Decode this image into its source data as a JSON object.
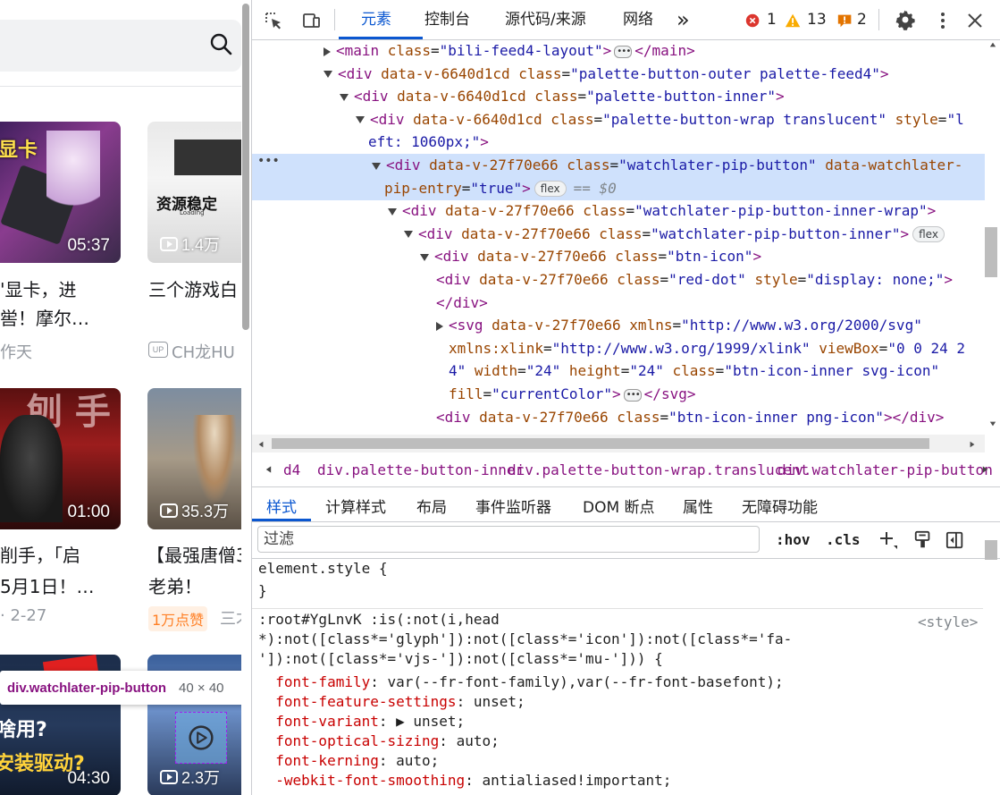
{
  "page": {
    "videos": [
      {
        "thumb_text": "显卡",
        "duration": "05:37",
        "title_line1": "'显卡，进",
        "title_line2": "喾！摩尔…",
        "meta": "作天"
      },
      {
        "thumb_text": "资源稳定",
        "loading": "Loading",
        "plays": "1.4万",
        "title_line1": "三个游戏白",
        "meta_prefix": "UP",
        "meta": "CH龙HU"
      },
      {
        "thumb_text": "刨 手",
        "duration": "01:00",
        "title_line1": "削手，「启",
        "title_line2": "5月1日！…",
        "meta": "· 2-27"
      },
      {
        "plays": "35.3万",
        "title_line1": "【最强唐僧3",
        "title_line2": "老弟！",
        "badge": "1万点赞",
        "meta": "三才"
      },
      {
        "thumb_text1": "啥用?",
        "thumb_text2": "安装驱动?",
        "duration": "04:30"
      },
      {
        "plays": "2.3万"
      }
    ],
    "tooltip": {
      "name": "div.watchlater-pip-button",
      "size": "40 × 40"
    }
  },
  "devtools": {
    "tabs": [
      {
        "label": "元素",
        "active": true
      },
      {
        "label": "控制台"
      },
      {
        "label": "源代码/来源"
      },
      {
        "label": "网络"
      }
    ],
    "more_tabs": "»",
    "counts": {
      "errors": "1",
      "warnings": "13",
      "issues": "2"
    },
    "tree": [
      {
        "indent": 80,
        "tri": "right",
        "parts": [
          [
            "tg",
            "<main "
          ],
          [
            "an",
            "class"
          ],
          [
            "pl",
            "="
          ],
          [
            "av",
            "\"bili-feed4-layout\""
          ],
          [
            "tg",
            ">"
          ]
        ],
        "dots": true,
        "tail": [
          [
            "tg",
            "</main>"
          ]
        ]
      },
      {
        "indent": 80,
        "tri": "down",
        "parts": [
          [
            "tg",
            "<div "
          ],
          [
            "an",
            "data-v-6640d1cd "
          ],
          [
            "an",
            "class"
          ],
          [
            "pl",
            "="
          ],
          [
            "av",
            "\"palette-button-outer palette-feed4\""
          ],
          [
            "tg",
            ">"
          ]
        ]
      },
      {
        "indent": 98,
        "tri": "down",
        "parts": [
          [
            "tg",
            "<div "
          ],
          [
            "an",
            "data-v-6640d1cd "
          ],
          [
            "an",
            "class"
          ],
          [
            "pl",
            "="
          ],
          [
            "av",
            "\"palette-button-inner\""
          ],
          [
            "tg",
            ">"
          ]
        ]
      },
      {
        "indent": 116,
        "tri": "down",
        "parts": [
          [
            "tg",
            "<div "
          ],
          [
            "an",
            "data-v-6640d1cd "
          ],
          [
            "an",
            "class"
          ],
          [
            "pl",
            "="
          ],
          [
            "av",
            "\"palette-button-wrap translucent\" "
          ],
          [
            "an",
            "style"
          ],
          [
            "pl",
            "="
          ],
          [
            "av",
            "\"l"
          ]
        ]
      },
      {
        "indent": 130,
        "tri": "",
        "parts": [
          [
            "av",
            "eft: 1060px;\""
          ],
          [
            "tg",
            ">"
          ]
        ]
      },
      {
        "indent": 134,
        "tri": "down",
        "sel": true,
        "parts": [
          [
            "tg",
            "<div "
          ],
          [
            "an",
            "data-v-27f70e66 "
          ],
          [
            "an",
            "class"
          ],
          [
            "pl",
            "="
          ],
          [
            "av",
            "\"watchlater-pip-button\" "
          ],
          [
            "an",
            "data-watchlater-"
          ]
        ]
      },
      {
        "indent": 148,
        "tri": "",
        "sel": true,
        "parts": [
          [
            "an",
            "pip-entry"
          ],
          [
            "pl",
            "="
          ],
          [
            "av",
            "\"true\""
          ],
          [
            "tg",
            ">"
          ]
        ],
        "pill": "flex",
        "eq": "== $0"
      },
      {
        "indent": 152,
        "tri": "down",
        "parts": [
          [
            "tg",
            "<div "
          ],
          [
            "an",
            "data-v-27f70e66 "
          ],
          [
            "an",
            "class"
          ],
          [
            "pl",
            "="
          ],
          [
            "av",
            "\"watchlater-pip-button-inner-wrap\""
          ],
          [
            "tg",
            ">"
          ]
        ]
      },
      {
        "indent": 170,
        "tri": "down",
        "parts": [
          [
            "tg",
            "<div "
          ],
          [
            "an",
            "data-v-27f70e66 "
          ],
          [
            "an",
            "class"
          ],
          [
            "pl",
            "="
          ],
          [
            "av",
            "\"watchlater-pip-button-inner\""
          ],
          [
            "tg",
            ">"
          ]
        ],
        "pill": "flex"
      },
      {
        "indent": 188,
        "tri": "down",
        "parts": [
          [
            "tg",
            "<div "
          ],
          [
            "an",
            "data-v-27f70e66 "
          ],
          [
            "an",
            "class"
          ],
          [
            "pl",
            "="
          ],
          [
            "av",
            "\"btn-icon\""
          ],
          [
            "tg",
            ">"
          ]
        ]
      },
      {
        "indent": 206,
        "tri": "",
        "parts": [
          [
            "tg",
            "<div "
          ],
          [
            "an",
            "data-v-27f70e66 "
          ],
          [
            "an",
            "class"
          ],
          [
            "pl",
            "="
          ],
          [
            "av",
            "\"red-dot\" "
          ],
          [
            "an",
            "style"
          ],
          [
            "pl",
            "="
          ],
          [
            "av",
            "\"display: none;\""
          ],
          [
            "tg",
            ">"
          ]
        ]
      },
      {
        "indent": 206,
        "tri": "",
        "parts": [
          [
            "tg",
            "</div>"
          ]
        ]
      },
      {
        "indent": 206,
        "tri": "right",
        "parts": [
          [
            "tg",
            "<svg "
          ],
          [
            "an",
            "data-v-27f70e66 "
          ],
          [
            "an",
            "xmlns"
          ],
          [
            "pl",
            "="
          ],
          [
            "av",
            "\"http://www.w3.org/2000/svg\""
          ]
        ]
      },
      {
        "indent": 220,
        "tri": "",
        "parts": [
          [
            "an",
            "xmlns:xlink"
          ],
          [
            "pl",
            "="
          ],
          [
            "av",
            "\"http://www.w3.org/1999/xlink\" "
          ],
          [
            "an",
            "viewBox"
          ],
          [
            "pl",
            "="
          ],
          [
            "av",
            "\"0 0 24 2"
          ]
        ]
      },
      {
        "indent": 220,
        "tri": "",
        "parts": [
          [
            "av",
            "4\" "
          ],
          [
            "an",
            "width"
          ],
          [
            "pl",
            "="
          ],
          [
            "av",
            "\"24\" "
          ],
          [
            "an",
            "height"
          ],
          [
            "pl",
            "="
          ],
          [
            "av",
            "\"24\" "
          ],
          [
            "an",
            "class"
          ],
          [
            "pl",
            "="
          ],
          [
            "av",
            "\"btn-icon-inner svg-icon\""
          ]
        ]
      },
      {
        "indent": 220,
        "tri": "",
        "parts": [
          [
            "an",
            "fill"
          ],
          [
            "pl",
            "="
          ],
          [
            "av",
            "\"currentColor\""
          ],
          [
            "tg",
            ">"
          ]
        ],
        "dots": true,
        "tail": [
          [
            "tg",
            "</svg>"
          ]
        ]
      },
      {
        "indent": 206,
        "tri": "",
        "parts": [
          [
            "tg",
            "<div "
          ],
          [
            "an",
            "data-v-27f70e66 "
          ],
          [
            "an",
            "class"
          ],
          [
            "pl",
            "="
          ],
          [
            "av",
            "\"btn-icon-inner png-icon\""
          ],
          [
            "tg",
            ">"
          ],
          [
            "tg",
            "</div>"
          ]
        ]
      },
      {
        "indent": 188,
        "tri": "",
        "parts": [
          [
            "tg",
            "</div>"
          ]
        ]
      }
    ],
    "breadcrumb": [
      "d4",
      "div.palette-button-inner",
      "div.palette-button-wrap.translucent",
      "div.watchlater-pip-button"
    ],
    "style_tabs": [
      "样式",
      "计算样式",
      "布局",
      "事件监听器",
      "DOM 断点",
      "属性",
      "无障碍功能"
    ],
    "filter_placeholder": "过滤",
    "filter_btns": {
      "hov": ":hov",
      "cls": ".cls"
    },
    "css_lines": [
      [
        [
          "pl",
          "element.style {"
        ]
      ],
      [
        [
          "pl",
          "}"
        ]
      ],
      [
        [
          "pl",
          ":root#YgLnvK :is(:not(i,head"
        ]
      ],
      [
        [
          "pl",
          "*):not([class*='glyph']):not([class*='icon']):not([class*='fa-"
        ]
      ],
      [
        [
          "pl",
          "']):not([class*='vjs-']):not([class*='mu-'])) {"
        ]
      ],
      [
        [
          "pr",
          "  font-family"
        ],
        [
          "pl",
          ": "
        ],
        [
          "vl",
          "var(--fr-font-family),var(--fr-font-basefont);"
        ]
      ],
      [
        [
          "pr",
          "  font-feature-settings"
        ],
        [
          "pl",
          ": "
        ],
        [
          "vl",
          "unset;"
        ]
      ],
      [
        [
          "pr",
          "  font-variant"
        ],
        [
          "pl",
          ": ▶ "
        ],
        [
          "vl",
          "unset;"
        ]
      ],
      [
        [
          "pr",
          "  font-optical-sizing"
        ],
        [
          "pl",
          ": "
        ],
        [
          "vl",
          "auto;"
        ]
      ],
      [
        [
          "pr",
          "  font-kerning"
        ],
        [
          "pl",
          ": "
        ],
        [
          "vl",
          "auto;"
        ]
      ],
      [
        [
          "pr",
          "  -webkit-font-smoothing"
        ],
        [
          "pl",
          ": "
        ],
        [
          "vl",
          "antialiased!important;"
        ]
      ]
    ],
    "css_source": "<style>"
  }
}
